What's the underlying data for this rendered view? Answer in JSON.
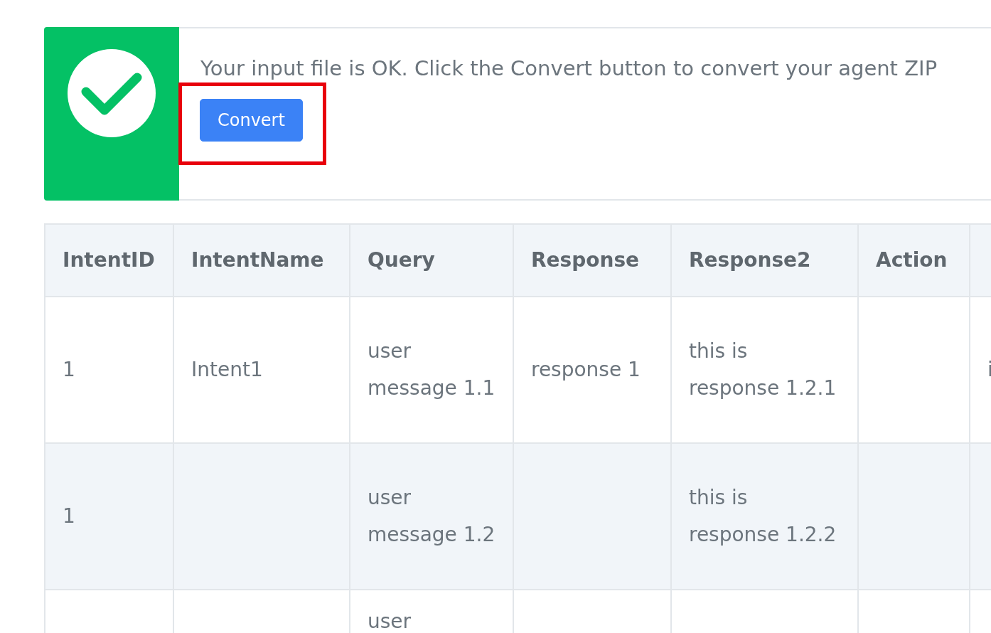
{
  "alert": {
    "kind": "success",
    "message": "Your input file is OK. Click the Convert button to convert your agent ZIP",
    "button": "Convert",
    "highlighted": true
  },
  "table": {
    "columns": [
      "IntentID",
      "IntentName",
      "Query",
      "Response",
      "Response2",
      "Action",
      ""
    ],
    "rows": [
      [
        "1",
        "Intent1",
        "user message 1.1",
        "response 1",
        "this is response 1.2.1",
        "",
        "i"
      ],
      [
        "1",
        "",
        "user message 1.2",
        "",
        "this is response 1.2.2",
        "",
        ""
      ],
      [
        "",
        "",
        "user",
        "",
        "",
        "",
        ""
      ]
    ]
  }
}
